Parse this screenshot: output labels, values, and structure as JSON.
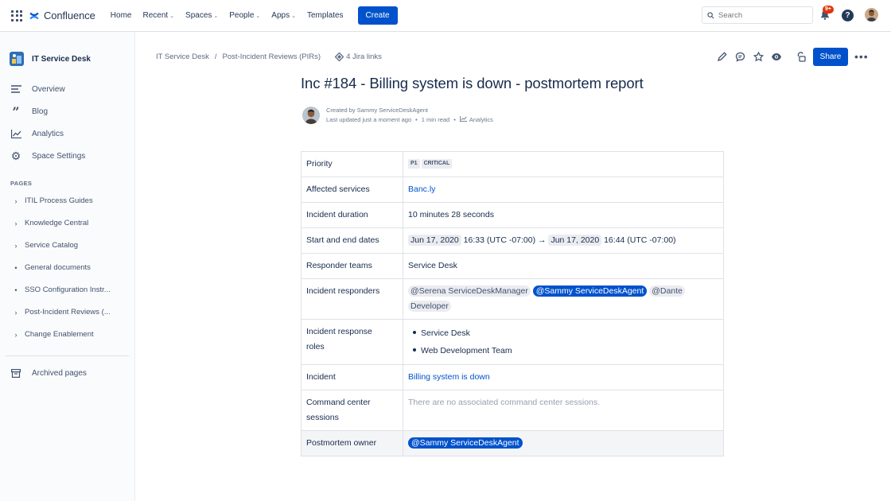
{
  "topnav": {
    "brand": "Confluence",
    "items": [
      {
        "label": "Home",
        "dropdown": false
      },
      {
        "label": "Recent",
        "dropdown": true
      },
      {
        "label": "Spaces",
        "dropdown": true
      },
      {
        "label": "People",
        "dropdown": true
      },
      {
        "label": "Apps",
        "dropdown": true
      },
      {
        "label": "Templates",
        "dropdown": false
      }
    ],
    "create_label": "Create",
    "search_placeholder": "Search",
    "notification_badge": "9+",
    "help_label": "?"
  },
  "sidebar": {
    "space_name": "IT Service Desk",
    "links": [
      {
        "label": "Overview",
        "icon": "overview-icon"
      },
      {
        "label": "Blog",
        "icon": "quote-icon"
      },
      {
        "label": "Analytics",
        "icon": "analytics-icon"
      },
      {
        "label": "Space Settings",
        "icon": "gear-icon"
      }
    ],
    "pages_label": "PAGES",
    "pages": [
      {
        "label": "ITIL Process Guides",
        "mark": "›"
      },
      {
        "label": "Knowledge Central",
        "mark": "›"
      },
      {
        "label": "Service Catalog",
        "mark": "›"
      },
      {
        "label": "General documents",
        "mark": "•"
      },
      {
        "label": "SSO Configuration Instr...",
        "mark": "•"
      },
      {
        "label": "Post-Incident Reviews (...",
        "mark": "›"
      },
      {
        "label": "Change Enablement",
        "mark": "›"
      }
    ],
    "archived_label": "Archived pages"
  },
  "breadcrumbs": {
    "items": [
      "IT Service Desk",
      "Post-Incident Reviews (PIRs)"
    ],
    "separator": "/",
    "jira_links": "4 Jira links"
  },
  "toolbar": {
    "share_label": "Share",
    "more_label": "•••"
  },
  "page": {
    "title": "Inc #184 - Billing system is down - postmortem report",
    "created_by": "Created by Sammy ServiceDeskAgent",
    "last_updated": "Last updated just a moment ago",
    "read_time": "1 min read",
    "analytics": "Analytics"
  },
  "table": {
    "priority": {
      "key": "Priority",
      "p": "P1",
      "level": "CRITICAL"
    },
    "affected": {
      "key": "Affected services",
      "value": "Banc.ly"
    },
    "duration": {
      "key": "Incident duration",
      "value": "10 minutes 28 seconds"
    },
    "dates": {
      "key": "Start and end dates",
      "start_date": "Jun 17, 2020",
      "start_time": "16:33 (UTC -07:00)",
      "arrow": "→",
      "end_date": "Jun 17, 2020",
      "end_time": "16:44 (UTC -07:00)"
    },
    "teams": {
      "key": "Responder teams",
      "value": "Service Desk"
    },
    "responders": {
      "key": "Incident responders",
      "m1": "@Serena ServiceDeskManager",
      "m2": "@Sammy ServiceDeskAgent",
      "m3a": "@Dante",
      "m3b": "Developer"
    },
    "roles": {
      "key_1": "Incident response",
      "key_2": "roles",
      "items": [
        "Service Desk",
        "Web Development Team"
      ]
    },
    "incident": {
      "key": "Incident",
      "value": "Billing system is down"
    },
    "command": {
      "key_1": "Command center",
      "key_2": "sessions",
      "value": "There are no associated command center sessions."
    },
    "owner": {
      "key": "Postmortem owner",
      "value": "@Sammy ServiceDeskAgent"
    }
  }
}
